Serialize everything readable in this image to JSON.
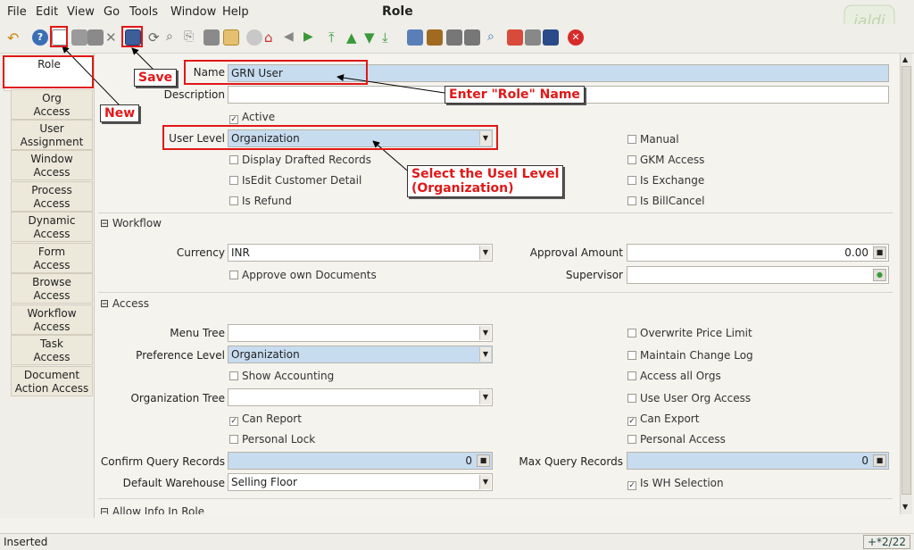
{
  "window": {
    "title": "Role"
  },
  "menu": [
    "File",
    "Edit",
    "View",
    "Go",
    "Tools",
    "Window",
    "Help"
  ],
  "logo_text": "jaldi",
  "tabs": [
    "Role",
    "Org\nAccess",
    "User\nAssignment",
    "Window\nAccess",
    "Process\nAccess",
    "Dynamic\nAccess",
    "Form\nAccess",
    "Browse\nAccess",
    "Workflow\nAccess",
    "Task\nAccess",
    "Document\nAction Access"
  ],
  "form": {
    "name_label": "Name",
    "name_value": "GRN User",
    "description_label": "Description",
    "description_value": "",
    "active_label": "Active",
    "user_level_label": "User Level",
    "user_level_value": "Organization",
    "display_drafted": "Display Drafted Records",
    "isedit_customer": "IsEdit Customer Detail",
    "is_refund": "Is Refund",
    "manual": "Manual",
    "gkm_access": "GKM Access",
    "is_exchange": "Is Exchange",
    "is_billcancel": "Is BillCancel"
  },
  "workflow": {
    "section_title": "Workflow",
    "currency_label": "Currency",
    "currency_value": "INR",
    "approve_own": "Approve own Documents",
    "approval_amount_label": "Approval Amount",
    "approval_amount_value": "0.00",
    "supervisor_label": "Supervisor",
    "supervisor_value": ""
  },
  "access": {
    "section_title": "Access",
    "menu_tree_label": "Menu Tree",
    "menu_tree_value": "",
    "preference_level_label": "Preference Level",
    "preference_level_value": "Organization",
    "show_accounting": "Show Accounting",
    "organization_tree_label": "Organization Tree",
    "organization_tree_value": "",
    "can_report": "Can Report",
    "personal_lock": "Personal Lock",
    "confirm_query_label": "Confirm Query Records",
    "confirm_query_value": "0",
    "default_warehouse_label": "Default Warehouse",
    "default_warehouse_value": "Selling Floor",
    "overwrite_price": "Overwrite Price Limit",
    "maintain_change_log": "Maintain Change Log",
    "access_all_orgs": "Access all Orgs",
    "use_user_org": "Use User Org Access",
    "can_export": "Can Export",
    "personal_access": "Personal Access",
    "max_query_label": "Max Query Records",
    "max_query_value": "0",
    "is_wh_selection": "Is WH Selection"
  },
  "allow_info_section": "Allow Info In Role",
  "annotations": {
    "new": "New",
    "save": "Save",
    "enter_role": "Enter \"Role\" Name",
    "select_level_1": "Select the Usel Level",
    "select_level_2": "(Organization)"
  },
  "status": {
    "text": "Inserted",
    "record": "+*2/22"
  },
  "colors": {
    "annotation": "#e01818",
    "selected_field": "#c8dcf0"
  }
}
